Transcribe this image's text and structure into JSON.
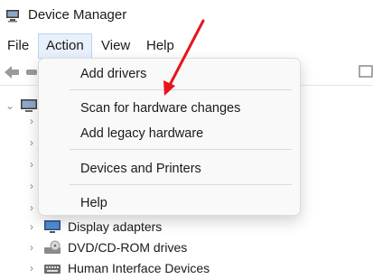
{
  "window": {
    "title": "Device Manager"
  },
  "menubar": {
    "items": [
      {
        "label": "File"
      },
      {
        "label": "Action"
      },
      {
        "label": "View"
      },
      {
        "label": "Help"
      }
    ]
  },
  "action_menu": {
    "items": [
      {
        "label": "Add drivers"
      },
      {
        "label": "Scan for hardware changes"
      },
      {
        "label": "Add legacy hardware"
      },
      {
        "label": "Devices and Printers"
      },
      {
        "label": "Help"
      }
    ]
  },
  "tree": {
    "visible_nodes": [
      {
        "label": "Display adapters",
        "icon": "display-adapter-icon"
      },
      {
        "label": "DVD/CD-ROM drives",
        "icon": "dvd-drive-icon"
      },
      {
        "label": "Human Interface Devices",
        "icon": "hid-icon"
      }
    ]
  },
  "colors": {
    "accent_arrow": "#e8141c",
    "menu_active_bg": "#e8f1fb",
    "menu_active_border": "#b7d3f3",
    "dropdown_bg": "#f9f9f9"
  }
}
